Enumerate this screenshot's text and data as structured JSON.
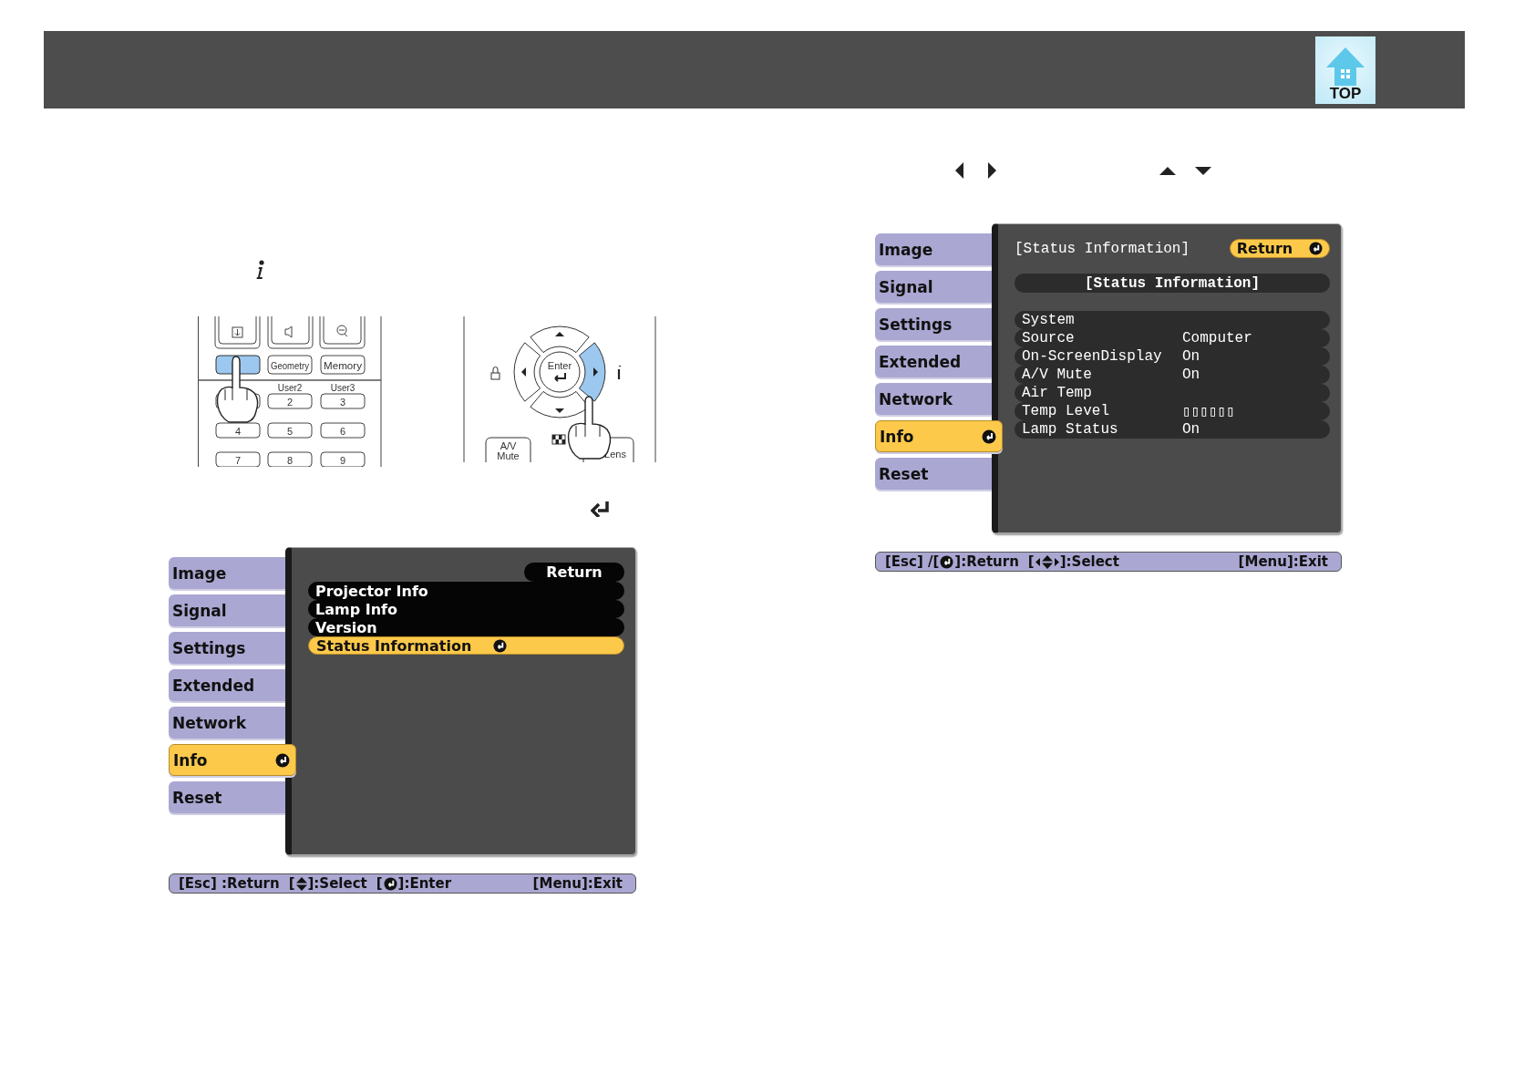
{
  "header": {
    "logo_text": "TOP"
  },
  "remote_keypad": {
    "top_keys": [
      "Geometry",
      "Memory"
    ],
    "user_labels": [
      "User2",
      "User3"
    ],
    "number_keys": [
      "2",
      "3",
      "4",
      "5",
      "6",
      "7",
      "8",
      "9"
    ]
  },
  "remote_dpad": {
    "center_key": "Enter",
    "mute_key": [
      "A/V",
      "Mute"
    ],
    "lens_key": "Lens"
  },
  "info_menu": {
    "sidebar": [
      {
        "label": "Image",
        "selected": false
      },
      {
        "label": "Signal",
        "selected": false
      },
      {
        "label": "Settings",
        "selected": false
      },
      {
        "label": "Extended",
        "selected": false
      },
      {
        "label": "Network",
        "selected": false
      },
      {
        "label": "Info",
        "selected": true
      },
      {
        "label": "Reset",
        "selected": false
      }
    ],
    "return_button": {
      "label": "Return",
      "selected": false
    },
    "items": [
      {
        "label": "Projector Info",
        "selected": false
      },
      {
        "label": "Lamp Info",
        "selected": false
      },
      {
        "label": "Version",
        "selected": false
      },
      {
        "label": "Status Information",
        "selected": true
      }
    ],
    "footer": {
      "hints": [
        {
          "kind": "plain",
          "before": "[Esc] :Return"
        },
        {
          "kind": "updown",
          "before": "[",
          "after": "]:Select"
        },
        {
          "kind": "enter",
          "before": "[",
          "after": "]:Enter"
        }
      ],
      "exit": "[Menu]:Exit"
    }
  },
  "status_menu": {
    "sidebar": [
      {
        "label": "Image",
        "selected": false
      },
      {
        "label": "Signal",
        "selected": false
      },
      {
        "label": "Settings",
        "selected": false
      },
      {
        "label": "Extended",
        "selected": false
      },
      {
        "label": "Network",
        "selected": false
      },
      {
        "label": "Info",
        "selected": true
      },
      {
        "label": "Reset",
        "selected": false
      }
    ],
    "title": "[Status Information]",
    "return_button": {
      "label": "Return",
      "selected": true
    },
    "section": "[Status Information]",
    "rows": [
      {
        "label": "System"
      },
      {
        "label": "Source",
        "value": "Computer"
      },
      {
        "label": "On-ScreenDisplay",
        "value": "On"
      },
      {
        "label": "A/V Mute",
        "value": "On"
      },
      {
        "label": "Air Temp"
      },
      {
        "label": "Temp Level",
        "value": "▯▯▯▯▯▯"
      },
      {
        "label": "Lamp Status",
        "value": "On"
      }
    ],
    "footer": {
      "hints": [
        {
          "kind": "enter",
          "before": "[Esc] /[",
          "after": "]:Return"
        },
        {
          "kind": "fourway",
          "before": "[",
          "after": "]:Select"
        }
      ],
      "exit": "[Menu]:Exit"
    }
  }
}
